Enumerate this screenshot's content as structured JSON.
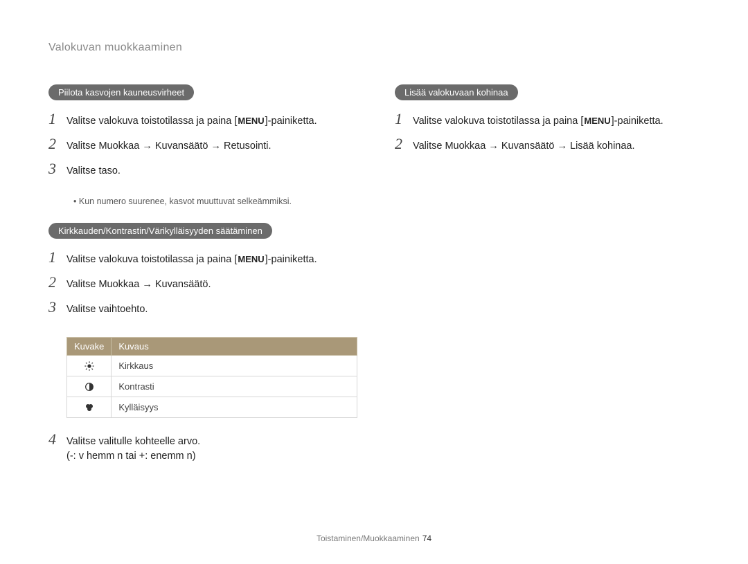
{
  "header": {
    "title": "Valokuvan muokkaaminen"
  },
  "left": {
    "section1": {
      "pill": "Piilota kasvojen kauneusvirheet",
      "steps": [
        {
          "num": "1",
          "pre": "Valitse valokuva toistotilassa ja paina [",
          "chip": "MENU",
          "post": "]-painiketta."
        },
        {
          "num": "2",
          "text": "Valitse Muokkaa → Kuvansäätö → Retusointi."
        },
        {
          "num": "3",
          "text": "Valitse taso."
        }
      ],
      "note": "Kun numero suurenee, kasvot muuttuvat selkeämmiksi."
    },
    "section2": {
      "pill": "Kirkkauden/Kontrastin/Värikylläisyyden säätäminen",
      "steps_a": [
        {
          "num": "1",
          "pre": "Valitse valokuva toistotilassa ja paina [",
          "chip": "MENU",
          "post": "]-painiketta."
        },
        {
          "num": "2",
          "text": "Valitse Muokkaa → Kuvansäätö."
        },
        {
          "num": "3",
          "text": "Valitse vaihtoehto."
        }
      ],
      "table": {
        "headers": {
          "icon": "Kuvake",
          "desc": "Kuvaus"
        },
        "rows": [
          {
            "icon": "brightness",
            "desc": "Kirkkaus"
          },
          {
            "icon": "contrast",
            "desc": "Kontrasti"
          },
          {
            "icon": "saturation",
            "desc": "Kylläisyys"
          }
        ]
      },
      "steps_b": [
        {
          "num": "4",
          "text": "Valitse valitulle kohteelle arvo."
        }
      ],
      "subnote": "(-: v hemm n tai +: enemm n)"
    }
  },
  "right": {
    "section1": {
      "pill": "Lisää valokuvaan kohinaa",
      "steps": [
        {
          "num": "1",
          "pre": "Valitse valokuva toistotilassa ja paina [",
          "chip": "MENU",
          "post": "]-painiketta."
        },
        {
          "num": "2",
          "text": "Valitse Muokkaa → Kuvansäätö → Lisää kohinaa."
        }
      ]
    }
  },
  "footer": {
    "text": "Toistaminen/Muokkaaminen",
    "page": "74"
  }
}
